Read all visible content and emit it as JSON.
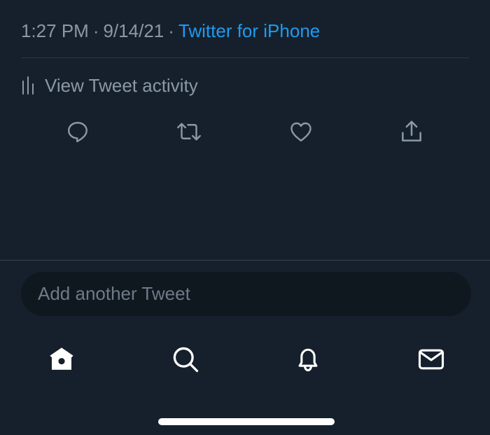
{
  "tweet_meta": {
    "time": "1:27 PM",
    "separator": "·",
    "date": "9/14/21",
    "source": "Twitter for iPhone"
  },
  "activity": {
    "label": "View Tweet activity",
    "icon": "bar-chart-icon"
  },
  "actions": [
    {
      "name": "reply",
      "icon": "reply-icon"
    },
    {
      "name": "retweet",
      "icon": "retweet-icon"
    },
    {
      "name": "like",
      "icon": "heart-icon"
    },
    {
      "name": "share",
      "icon": "share-icon"
    }
  ],
  "composer": {
    "placeholder": "Add another Tweet"
  },
  "tabbar": [
    {
      "name": "home",
      "icon": "home-icon",
      "active": true
    },
    {
      "name": "search",
      "icon": "search-icon",
      "active": false
    },
    {
      "name": "notifications",
      "icon": "bell-icon",
      "active": false
    },
    {
      "name": "messages",
      "icon": "mail-icon",
      "active": false
    }
  ],
  "colors": {
    "background": "#16202c",
    "muted_text": "#8b98a5",
    "accent": "#1d9bf0",
    "composer_bg": "#0f171f",
    "icon_white": "#ffffff"
  }
}
